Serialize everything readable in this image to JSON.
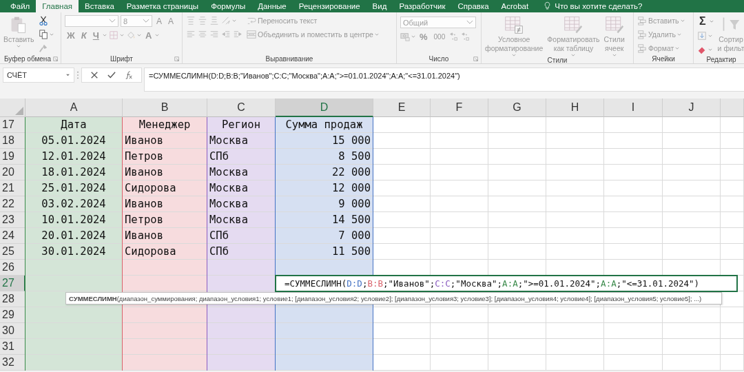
{
  "menu_tabs": [
    {
      "label": "Файл",
      "selected": false
    },
    {
      "label": "Главная",
      "selected": true
    },
    {
      "label": "Вставка",
      "selected": false
    },
    {
      "label": "Разметка страницы",
      "selected": false
    },
    {
      "label": "Формулы",
      "selected": false
    },
    {
      "label": "Данные",
      "selected": false
    },
    {
      "label": "Рецензирование",
      "selected": false
    },
    {
      "label": "Вид",
      "selected": false
    },
    {
      "label": "Разработчик",
      "selected": false
    },
    {
      "label": "Справка",
      "selected": false
    },
    {
      "label": "Acrobat",
      "selected": false
    }
  ],
  "tell_me": {
    "placeholder": "Что вы хотите сделать?"
  },
  "ribbon": {
    "groups": [
      {
        "label": "Буфер обмена",
        "launcher": true,
        "columns": [
          [
            [
              {
                "kind": "paste",
                "label": "Вставить",
                "disabled": true,
                "dropdown": true
              }
            ]
          ],
          [
            [
              {
                "kind": "cut",
                "disabled": false
              }
            ],
            [
              {
                "kind": "copy",
                "disabled": false,
                "dropdown": true
              }
            ],
            [
              {
                "kind": "painter",
                "disabled": true
              }
            ]
          ]
        ]
      },
      {
        "label": "Шрифт",
        "launcher": true,
        "columns": [
          [
            [
              {
                "kind": "field",
                "disabled": true
              },
              {
                "kind": "size-field",
                "value": "8",
                "disabled": true
              },
              {
                "kind": "grow",
                "label": "A",
                "disabled": true
              },
              {
                "kind": "shrink",
                "label": "A",
                "disabled": true
              }
            ],
            [
              {
                "kind": "letter",
                "label": "Ж",
                "disabled": true
              },
              {
                "kind": "italic",
                "label": "К",
                "disabled": true
              },
              {
                "kind": "underline",
                "label": "Ч",
                "disabled": true,
                "dropdown": true
              },
              {
                "kind": "borders",
                "disabled": true,
                "dropdown": true
              },
              {
                "kind": "fill",
                "disabled": true,
                "dropdown": true
              },
              {
                "kind": "letter",
                "label": "A",
                "disabled": true,
                "dropdown": true
              }
            ]
          ]
        ]
      },
      {
        "label": "Выравнивание",
        "launcher": false,
        "columns": [
          [
            [
              {
                "kind": "align-top",
                "disabled": true
              },
              {
                "kind": "align-middle",
                "disabled": true
              },
              {
                "kind": "align-bottom",
                "disabled": true
              },
              {
                "kind": "orientation",
                "disabled": true,
                "dropdown": true
              }
            ],
            [
              {
                "kind": "align-left",
                "disabled": true
              },
              {
                "kind": "align-center",
                "disabled": true
              },
              {
                "kind": "align-right",
                "disabled": true
              },
              {
                "kind": "outdent",
                "disabled": true
              },
              {
                "kind": "indent",
                "disabled": true
              }
            ]
          ],
          [
            [
              {
                "kind": "wrap",
                "label": "Переносить текст",
                "disabled": true
              }
            ],
            [
              {
                "kind": "merge",
                "label": "Объединить и поместить в центре",
                "disabled": true,
                "dropdown": true
              }
            ]
          ]
        ]
      },
      {
        "label": "Число",
        "launcher": true,
        "columns": [
          [
            [
              {
                "kind": "number-field",
                "value": "Общий",
                "disabled": true
              }
            ],
            [
              {
                "kind": "currency",
                "disabled": true,
                "dropdown": true
              },
              {
                "kind": "letter",
                "label": "%",
                "disabled": true
              },
              {
                "kind": "small-letter",
                "label": "000",
                "disabled": true
              },
              {
                "kind": "increase-decimal",
                "disabled": true
              },
              {
                "kind": "decrease-decimal",
                "disabled": true
              }
            ]
          ]
        ]
      },
      {
        "label": "Стили",
        "launcher": false,
        "columns": [
          [
            [
              {
                "kind": "conditional",
                "label": "Условное\nформатирование",
                "disabled": true,
                "dropdown": true
              }
            ]
          ],
          [
            [
              {
                "kind": "table",
                "label": "Форматировать\nкак таблицу",
                "disabled": true,
                "dropdown": true
              }
            ]
          ],
          [
            [
              {
                "kind": "cell-styles",
                "label": "Стили\nячеек",
                "disabled": true,
                "dropdown": true
              }
            ]
          ]
        ]
      },
      {
        "label": "Ячейки",
        "launcher": false,
        "columns": [
          [
            [
              {
                "kind": "insert-cells",
                "label": "Вставить",
                "disabled": true,
                "dropdown": true
              }
            ],
            [
              {
                "kind": "delete-cells",
                "label": "Удалить",
                "disabled": true,
                "dropdown": true
              }
            ],
            [
              {
                "kind": "format-cells",
                "label": "Формат",
                "disabled": true,
                "dropdown": true
              }
            ]
          ]
        ]
      },
      {
        "label": "Редактир",
        "launcher": false,
        "columns": [
          [
            [
              {
                "kind": "sigma",
                "label": "Σ",
                "disabled": false,
                "dropdown": true
              }
            ],
            [
              {
                "kind": "fill-down",
                "disabled": true,
                "dropdown": true
              }
            ],
            [
              {
                "kind": "clear",
                "disabled": false,
                "dropdown": true
              }
            ]
          ],
          [
            [
              {
                "kind": "sort",
                "label": "Сортир\nи фильт",
                "disabled": true
              }
            ]
          ]
        ]
      }
    ]
  },
  "name_box": {
    "value": "СЧЁТ"
  },
  "formula_bar": {
    "value": "=СУММЕСЛИМН(D:D;B:B;\"Иванов\";C:C;\"Москва\";A:A;\">=01.01.2024\";A:A;\"<=31.01.2024\")"
  },
  "columns": [
    {
      "letter": "A",
      "selected": false,
      "color": "#3a8a4a"
    },
    {
      "letter": "B",
      "selected": false,
      "color": "#d9626b"
    },
    {
      "letter": "C",
      "selected": false,
      "color": "#8a5cc0"
    },
    {
      "letter": "D",
      "selected": true,
      "color": "#4472c4"
    },
    {
      "letter": "E",
      "selected": false
    },
    {
      "letter": "F",
      "selected": false
    },
    {
      "letter": "G",
      "selected": false
    },
    {
      "letter": "H",
      "selected": false
    },
    {
      "letter": "I",
      "selected": false
    },
    {
      "letter": "J",
      "selected": false
    }
  ],
  "rows": [
    {
      "number": "17",
      "selected": false,
      "cells": [
        "Дата",
        "Менеджер",
        "Регион",
        "Сумма продаж"
      ],
      "kind": "header"
    },
    {
      "number": "18",
      "selected": false,
      "cells": [
        "05.01.2024",
        "Иванов",
        "Москва",
        "15 000"
      ],
      "kind": "data"
    },
    {
      "number": "19",
      "selected": false,
      "cells": [
        "12.01.2024",
        "Петров",
        "СПб",
        "8 500"
      ],
      "kind": "data"
    },
    {
      "number": "20",
      "selected": false,
      "cells": [
        "18.01.2024",
        "Иванов",
        "Москва",
        "22 000"
      ],
      "kind": "data"
    },
    {
      "number": "21",
      "selected": false,
      "cells": [
        "25.01.2024",
        "Сидорова",
        "Москва",
        "12 000"
      ],
      "kind": "data"
    },
    {
      "number": "22",
      "selected": false,
      "cells": [
        "03.02.2024",
        "Иванов",
        "Москва",
        "9 000"
      ],
      "kind": "data"
    },
    {
      "number": "23",
      "selected": false,
      "cells": [
        "10.01.2024",
        "Петров",
        "Москва",
        "14 500"
      ],
      "kind": "data"
    },
    {
      "number": "24",
      "selected": false,
      "cells": [
        "20.01.2024",
        "Иванов",
        "СПб",
        "7 000"
      ],
      "kind": "data"
    },
    {
      "number": "25",
      "selected": false,
      "cells": [
        "30.01.2024",
        "Сидорова",
        "СПб",
        "11 500"
      ],
      "kind": "data"
    },
    {
      "number": "26",
      "selected": false,
      "cells": [],
      "kind": "data"
    },
    {
      "number": "27",
      "selected": true,
      "cells": [],
      "kind": "data"
    },
    {
      "number": "28",
      "selected": false,
      "cells": [],
      "kind": "data"
    },
    {
      "number": "29",
      "selected": false,
      "cells": [],
      "kind": "data"
    },
    {
      "number": "30",
      "selected": false,
      "cells": [],
      "kind": "data"
    },
    {
      "number": "31",
      "selected": false,
      "cells": [],
      "kind": "data"
    },
    {
      "number": "32",
      "selected": false,
      "cells": [],
      "kind": "data"
    }
  ],
  "edit_cell": {
    "tokens": [
      {
        "text": "=СУММЕСЛИМН("
      },
      {
        "text": "D:D",
        "color": "#4472c4"
      },
      {
        "text": ";"
      },
      {
        "text": "B:B",
        "color": "#d9626b"
      },
      {
        "text": ";\"Иванов\";"
      },
      {
        "text": "C:C",
        "color": "#8a5cc0"
      },
      {
        "text": ";\"Москва\";"
      },
      {
        "text": "A:A",
        "color": "#3a8a4a"
      },
      {
        "text": ";\">=01.01.2024\";"
      },
      {
        "text": "A:A",
        "color": "#3a8a4a"
      },
      {
        "text": ";\"<=31.01.2024\")"
      }
    ]
  },
  "tooltip": {
    "text": "**СУММЕСЛИМН**(диапазон_суммирования; диапазон_условия1; условие1; [диапазон_условия2; условие2]; [диапазон_условия3; условие3]; [диапазон_условия4; условие4]; [диапазон_условия5; условие5]; ...)"
  }
}
